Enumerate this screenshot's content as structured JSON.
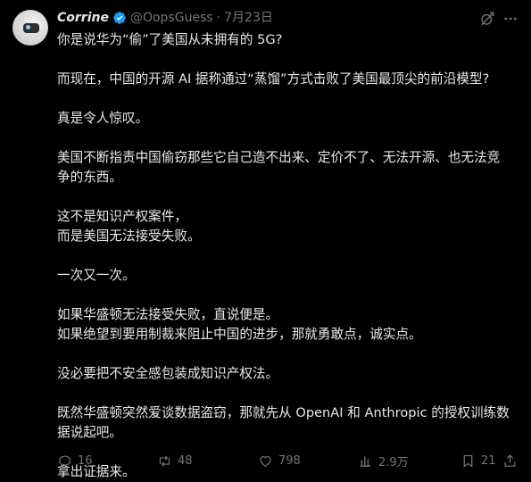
{
  "author": {
    "name": "Corrine",
    "handle": "@OopsGuess",
    "separator": "·",
    "date": "7月23日"
  },
  "body": {
    "paragraphs": [
      "你是说华为“偷”了美国从未拥有的 5G?",
      "而现在，中国的开源 AI 据称通过“蒸馏”方式击败了美国最顶尖的前沿模型?",
      "真是令人惊叹。",
      "美国不断指责中国偷窃那些它自己造不出来、定价不了、无法开源、也无法竞\n争的东西。",
      "这不是知识产权案件，\n而是美国无法接受失败。",
      "一次又一次。",
      "如果华盛顿无法接受失败，直说便是。\n如果绝望到要用制裁来阻止中国的进步，那就勇敢点，诚实点。",
      "没必要把不安全感包装成知识产权法。",
      "既然华盛顿突然爱谈数据盗窃，那就先从 OpenAI 和 Anthropic 的授权训练数\n据说起吧。",
      "拿出证据来。"
    ]
  },
  "actions": {
    "replies": "16",
    "reposts": "48",
    "likes": "798",
    "views": "2.9万",
    "bookmarks": "21"
  },
  "icons": {
    "verified": "verified-badge-icon",
    "grok": "grok-icon",
    "more": "more-icon",
    "reply": "reply-icon",
    "repost": "repost-icon",
    "like": "like-icon",
    "views": "views-icon",
    "bookmark": "bookmark-icon",
    "share": "share-icon"
  },
  "colors": {
    "background": "#000000",
    "text": "#e7e9ea",
    "muted": "#71767b",
    "verified": "#1d9bf0"
  }
}
